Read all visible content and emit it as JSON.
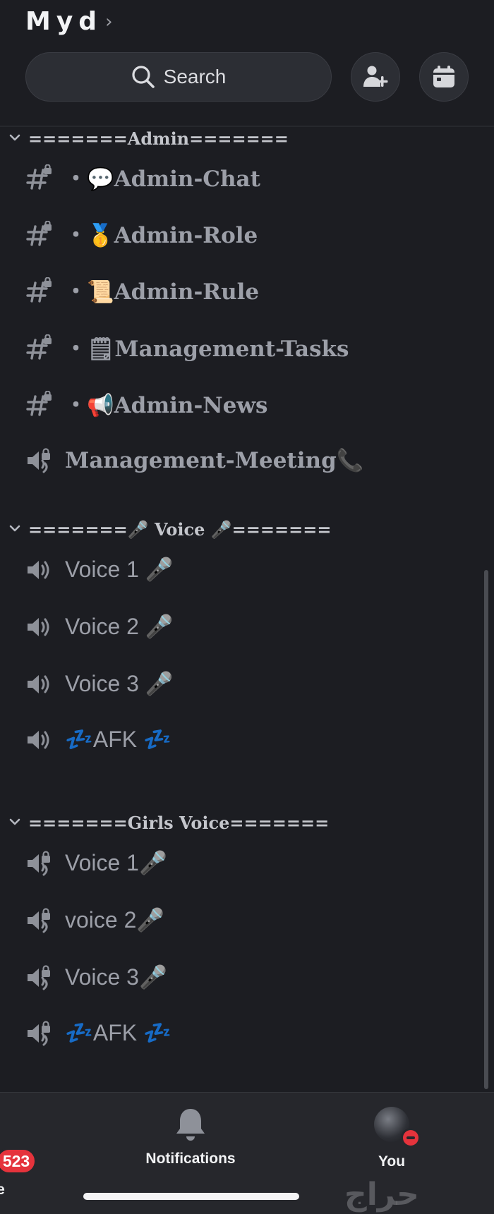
{
  "server": {
    "name": "Myd",
    "chevron": "›"
  },
  "search": {
    "label": "Search"
  },
  "header_buttons": {
    "invite_icon": "add-member-icon",
    "events_icon": "calendar-icon"
  },
  "categories": [
    {
      "label": "=======Admin======="
    },
    {
      "label": "=======🎤 Voice 🎤======="
    },
    {
      "label": "=======Girls Voice======="
    }
  ],
  "admin_channels": [
    {
      "name": "・💬Admin-Chat",
      "type": "text-locked"
    },
    {
      "name": "・🥇Admin-Role",
      "type": "text-locked"
    },
    {
      "name": "・📜Admin-Rule",
      "type": "text-locked"
    },
    {
      "name": "・🗒Management-Tasks",
      "type": "text-locked"
    },
    {
      "name": "・📢Admin-News",
      "type": "text-locked"
    },
    {
      "name": "Management-Meeting📞",
      "type": "voice-locked"
    }
  ],
  "voice_channels": [
    {
      "name": "Voice 1 🎤",
      "type": "voice"
    },
    {
      "name": "Voice 2 🎤",
      "type": "voice"
    },
    {
      "name": "Voice 3 🎤",
      "type": "voice"
    },
    {
      "name": "💤AFK 💤",
      "type": "voice"
    }
  ],
  "girls_channels": [
    {
      "name": "Voice 1🎤",
      "type": "voice-locked"
    },
    {
      "name": "voice 2🎤",
      "type": "voice-locked"
    },
    {
      "name": "Voice 3🎤",
      "type": "voice-locked"
    },
    {
      "name": "💤AFK 💤",
      "type": "voice-locked"
    }
  ],
  "bottom_nav": {
    "home_label": "e",
    "home_badge": "523",
    "notifications_label": "Notifications",
    "you_label": "You"
  },
  "watermark": "حراج",
  "colors": {
    "background": "#1c1d22",
    "badge": "#e5333c",
    "channel_text": "#9c9fa8"
  }
}
